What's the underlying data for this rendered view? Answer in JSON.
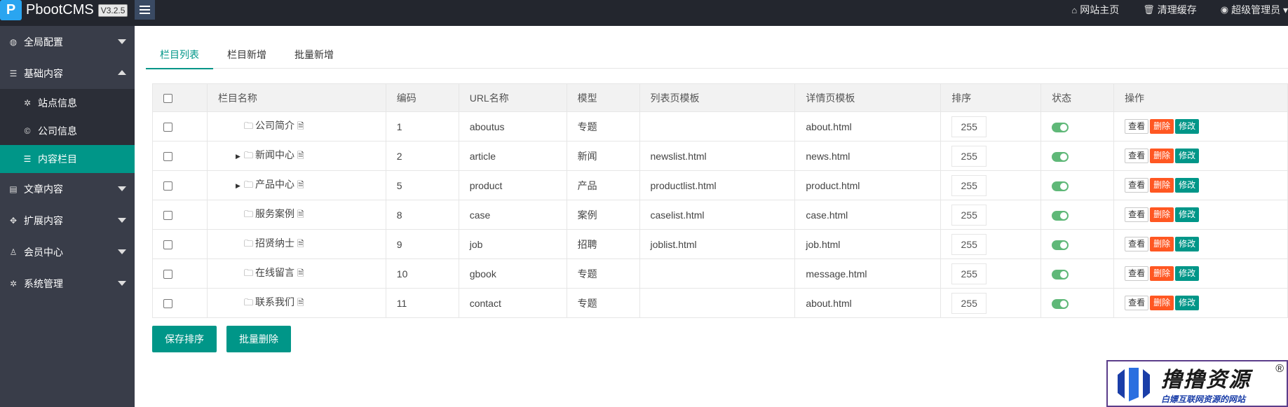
{
  "header": {
    "logo_mark": "P",
    "app_name": "PbootCMS",
    "version": "V3.2.5",
    "links": [
      {
        "icon": "home-icon",
        "glyph": "⌂",
        "label": "网站主页"
      },
      {
        "icon": "trash-icon",
        "glyph": "🗑",
        "label": "清理缓存"
      },
      {
        "icon": "user-icon",
        "glyph": "◉",
        "label": "超级管理员 ▾"
      }
    ]
  },
  "sidebar": {
    "groups": [
      {
        "icon": "globe-icon",
        "glyph": "◍",
        "label": "全局配置"
      },
      {
        "icon": "sliders-icon",
        "glyph": "☰",
        "label": "基础内容"
      },
      {
        "icon": "file-icon",
        "glyph": "▤",
        "label": "文章内容"
      },
      {
        "icon": "expand-icon",
        "glyph": "✥",
        "label": "扩展内容"
      },
      {
        "icon": "user-icon",
        "glyph": "♙",
        "label": "会员中心"
      },
      {
        "icon": "gear-icon",
        "glyph": "✲",
        "label": "系统管理"
      }
    ],
    "sub_items": [
      {
        "icon": "gear-icon",
        "glyph": "✲",
        "label": "站点信息"
      },
      {
        "icon": "copyright-icon",
        "glyph": "©",
        "label": "公司信息"
      },
      {
        "icon": "list-icon",
        "glyph": "☰",
        "label": "内容栏目"
      }
    ]
  },
  "tabs": [
    "栏目列表",
    "栏目新增",
    "批量新增"
  ],
  "table": {
    "headers": [
      "栏目名称",
      "编码",
      "URL名称",
      "模型",
      "列表页模板",
      "详情页模板",
      "排序",
      "状态",
      "操作"
    ],
    "rows": [
      {
        "name": "公司简介",
        "code": "1",
        "url": "aboutus",
        "model": "专题",
        "list_tpl": "",
        "detail_tpl": "about.html",
        "sort": "255",
        "expandable": false
      },
      {
        "name": "新闻中心",
        "code": "2",
        "url": "article",
        "model": "新闻",
        "list_tpl": "newslist.html",
        "detail_tpl": "news.html",
        "sort": "255",
        "expandable": true
      },
      {
        "name": "产品中心",
        "code": "5",
        "url": "product",
        "model": "产品",
        "list_tpl": "productlist.html",
        "detail_tpl": "product.html",
        "sort": "255",
        "expandable": true
      },
      {
        "name": "服务案例",
        "code": "8",
        "url": "case",
        "model": "案例",
        "list_tpl": "caselist.html",
        "detail_tpl": "case.html",
        "sort": "255",
        "expandable": false
      },
      {
        "name": "招贤纳士",
        "code": "9",
        "url": "job",
        "model": "招聘",
        "list_tpl": "joblist.html",
        "detail_tpl": "job.html",
        "sort": "255",
        "expandable": false
      },
      {
        "name": "在线留言",
        "code": "10",
        "url": "gbook",
        "model": "专题",
        "list_tpl": "",
        "detail_tpl": "message.html",
        "sort": "255",
        "expandable": false
      },
      {
        "name": "联系我们",
        "code": "11",
        "url": "contact",
        "model": "专题",
        "list_tpl": "",
        "detail_tpl": "about.html",
        "sort": "255",
        "expandable": false
      }
    ],
    "row_actions": {
      "view": "查看",
      "delete": "删除",
      "edit": "修改"
    }
  },
  "footer_buttons": {
    "save_sort": "保存排序",
    "batch_delete": "批量删除"
  },
  "watermark": {
    "title": "撸撸资源",
    "subtitle": "白嫖互联网资源的网站",
    "reg": "®"
  },
  "colors": {
    "accent": "#009688",
    "danger": "#ff5722",
    "switch_on": "#5fb878",
    "header_bg": "#23262e",
    "sidebar_bg": "#393d49"
  }
}
